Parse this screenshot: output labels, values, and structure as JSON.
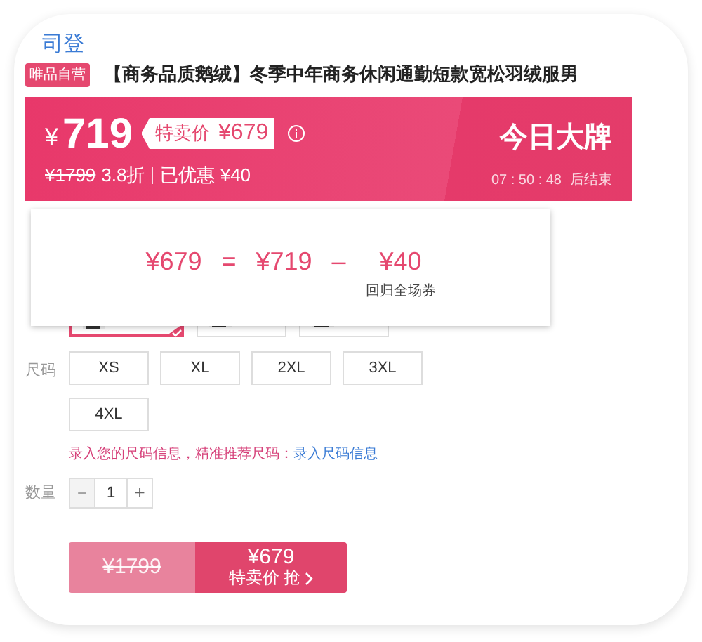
{
  "top_link": "司登",
  "badge": "唯品自营",
  "title": "【商务品质鹅绒】冬季中年商务休闲通勤短款宽松羽绒服男",
  "price_banner": {
    "currency": "¥",
    "price": "719",
    "special_label": "特卖价",
    "special_price": "¥679",
    "original_price": "¥1799",
    "discount": "3.8折",
    "saved": "已优惠 ¥40",
    "brand_title": "今日大牌",
    "countdown": "07 : 50 : 48",
    "countdown_suffix": "后结束"
  },
  "colors": [
    {
      "kind": "picture",
      "selected": true
    },
    {
      "kind": "picture",
      "selected": false
    },
    {
      "kind": "picture",
      "selected": false
    }
  ],
  "price_popup": {
    "final": "¥679",
    "equals": "=",
    "price": "¥719",
    "minus": "–",
    "coupon_amount": "¥40",
    "coupon_label": "回归全场券"
  },
  "size": {
    "label": "尺码",
    "options": [
      {
        "label": "XS",
        "selected": false
      },
      {
        "label": "XL",
        "selected": false
      },
      {
        "label": "2XL",
        "selected": false
      },
      {
        "label": "3XL",
        "selected": false
      },
      {
        "label": "4XL",
        "selected": false
      }
    ]
  },
  "size_tip": {
    "text": "录入您的尺码信息，精准推荐尺码：",
    "link": "录入尺码信息"
  },
  "quantity": {
    "label": "数量",
    "minus": "−",
    "value": "1",
    "plus": "+",
    "minus_disabled": true
  },
  "buy_button": {
    "original_price": "¥1799",
    "price": "¥679",
    "label": "特卖价 抢"
  }
}
